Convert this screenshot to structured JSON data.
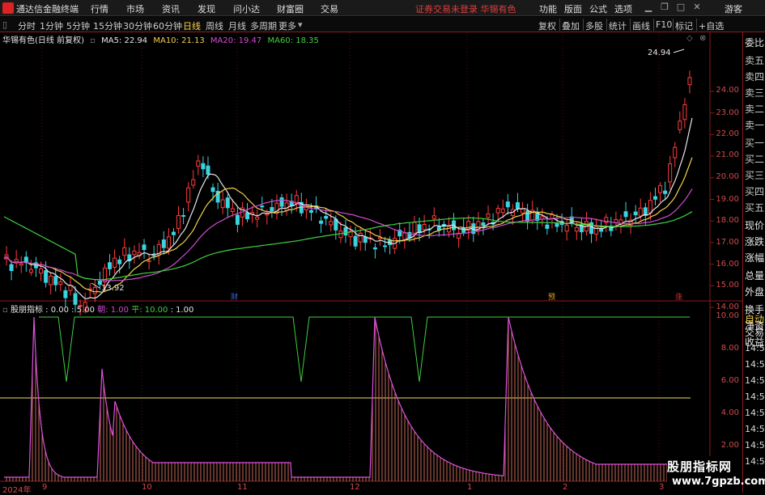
{
  "menubar": {
    "app_title": "通达信金融终端",
    "menu_items": [
      "行情",
      "市场",
      "资讯",
      "发现",
      "问小达",
      "财富圈",
      "交易"
    ],
    "notice": "证券交易未登录  华锡有色",
    "right_items": [
      "功能",
      "版面",
      "公式",
      "选项"
    ],
    "user": "游客"
  },
  "toolbar": {
    "periods": [
      "分时",
      "1分钟",
      "5分钟",
      "15分钟",
      "30分钟",
      "60分钟",
      "日线",
      "周线",
      "月线",
      "多周期",
      "更多"
    ],
    "active_period": "日线",
    "right_buttons": [
      "复权",
      "叠加",
      "多股",
      "统计",
      "画线",
      "F10",
      "标记",
      "+自选"
    ]
  },
  "main_chart": {
    "title": "华锡有色(日线 前复权)",
    "ma": [
      {
        "label": "MA5: 22.94",
        "color": "#e6e6e6"
      },
      {
        "label": "MA10: 21.13",
        "color": "#f0d050"
      },
      {
        "label": "MA20: 19.47",
        "color": "#d24bd2"
      },
      {
        "label": "MA60: 18.35",
        "color": "#40d040"
      }
    ],
    "y_ticks": [
      "24.00",
      "23.00",
      "22.00",
      "21.00",
      "20.00",
      "19.00",
      "18.00",
      "17.00",
      "16.00",
      "15.00",
      "14.00"
    ],
    "high_label": "24.94",
    "low_label": "13.92",
    "markers": [
      {
        "text": "财",
        "color": "#3a6ad8"
      },
      {
        "text": "预",
        "color": "#e0a020"
      },
      {
        "text": "涨",
        "color": "#e03030"
      }
    ]
  },
  "indicator": {
    "name": "股朋指标",
    "params": [
      {
        "text": ": 0.00",
        "color": "#e6e6e6"
      },
      {
        "text": ": 5.00",
        "color": "#e6e6e6"
      },
      {
        "text": "朝: 1.00",
        "color": "#d24bd2"
      },
      {
        "text": "平: 10.00",
        "color": "#40d040"
      },
      {
        "text": ": 1.00",
        "color": "#e6e6e6"
      }
    ],
    "y_ticks": [
      "10.00",
      "8.00",
      "6.00",
      "4.00",
      "2.00"
    ]
  },
  "x_axis": [
    "2024年",
    "9",
    "10",
    "11",
    "12",
    "1",
    "2",
    "3"
  ],
  "right_panel": {
    "items": [
      "委比",
      "卖五",
      "卖四",
      "卖三",
      "卖二",
      "卖一",
      "买一",
      "买二",
      "买三",
      "买四",
      "买五",
      "现价",
      "涨跌",
      "涨幅",
      "总量",
      "外盘",
      "换手",
      "净资",
      "收益"
    ],
    "lower_items": [
      "自动",
      "交易"
    ],
    "times": [
      "14:56",
      "14:56",
      "14:56",
      "14:56",
      "14:56",
      "14:56",
      "14:56",
      "14:56"
    ]
  },
  "watermark": {
    "line1": "股朋指标网",
    "line2": "www.7gpzb.com"
  }
}
